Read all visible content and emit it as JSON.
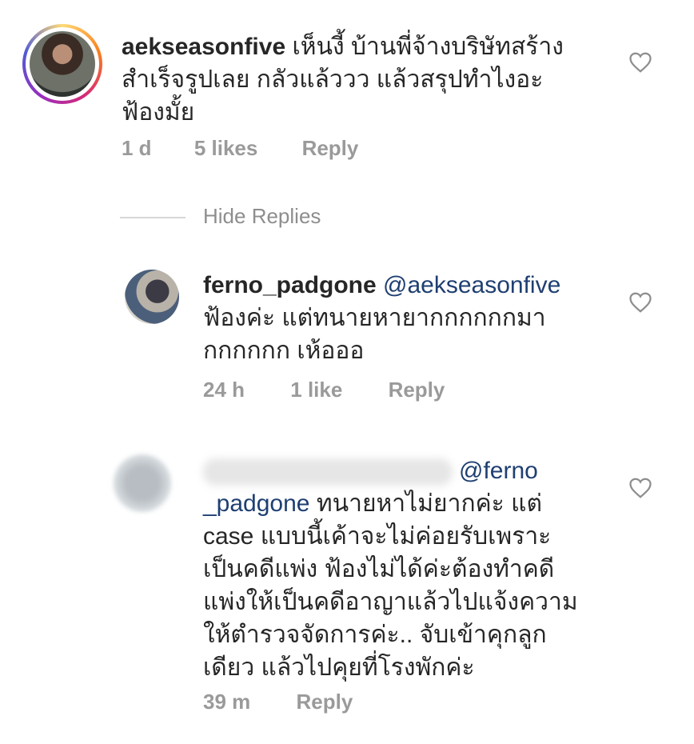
{
  "comments": [
    {
      "username": "aekseasonfive",
      "line1": "เห็นงี้ บ้านพี่จ้างบริษัทสร้าง",
      "line2": "สำเร็จรูปเลย กลัวแล้ววว แล้วสรุปทำไงอะ",
      "line3": "ฟ้องมั้ย",
      "time": "1 d",
      "likes": "5 likes",
      "reply": "Reply"
    }
  ],
  "hide_replies": "Hide Replies",
  "replies": [
    {
      "username": "ferno_padgone",
      "mention": "@aekseasonfive",
      "line1": "ฟ้องค่ะ แต่ทนายหายากกกกกกมา",
      "line2": "กกกกกก เห้อออ",
      "time": "24 h",
      "likes": "1 like",
      "reply": "Reply"
    },
    {
      "mention_part1": "@ferno",
      "mention_part2": "_padgone",
      "line1_rest": "ทนายหาไม่ยากค่ะ  แต่",
      "line2": "case แบบนี้เค้าจะไม่ค่อยรับเพราะ",
      "line3": "เป็นคดีแพ่ง ฟ้องไม่ได้ค่ะต้องทำคดี",
      "line4": "แพ่งให้เป็นคดีอาญาแล้วไปแจ้งความ",
      "line5": "ให้ตำรวจจัดการค่ะ.. จับเข้าคุกลูก",
      "line6": "เดียว แล้วไปคุยที่โรงพักค่ะ",
      "time": "39 m",
      "reply": "Reply"
    }
  ]
}
